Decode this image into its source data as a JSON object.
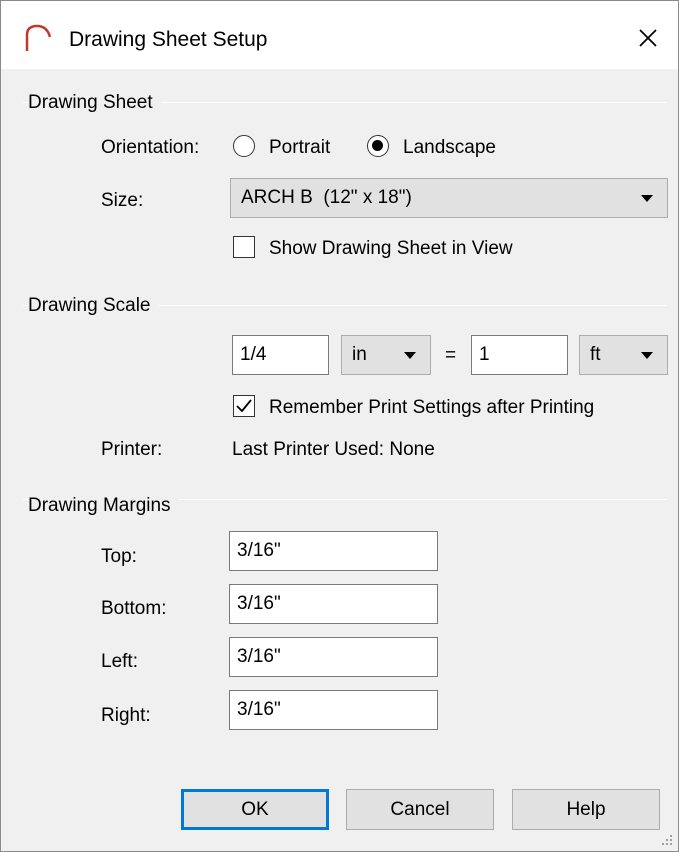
{
  "window": {
    "title": "Drawing Sheet Setup",
    "icon": "arch-icon",
    "accent_color": "#0078d7",
    "icon_color": "#c0392b"
  },
  "drawing_sheet": {
    "group_label": "Drawing Sheet",
    "orientation_label": "Orientation:",
    "portrait_label": "Portrait",
    "landscape_label": "Landscape",
    "orientation_selected": "Landscape",
    "size_label": "Size:",
    "size_value": "ARCH B  (12\" x 18\")",
    "show_sheet_label": "Show Drawing Sheet in View",
    "show_sheet_checked": false
  },
  "drawing_scale": {
    "group_label": "Drawing Scale",
    "left_value": "1/4",
    "left_unit": "in",
    "equals": "=",
    "right_value": "1",
    "right_unit": "ft",
    "remember_label": "Remember Print Settings after Printing",
    "remember_checked": true,
    "printer_label": "Printer:",
    "printer_value": "Last Printer Used: None"
  },
  "drawing_margins": {
    "group_label": "Drawing Margins",
    "top_label": "Top:",
    "top_value": "3/16\"",
    "bottom_label": "Bottom:",
    "bottom_value": "3/16\"",
    "left_label": "Left:",
    "left_value": "3/16\"",
    "right_label": "Right:",
    "right_value": "3/16\""
  },
  "buttons": {
    "ok": "OK",
    "cancel": "Cancel",
    "help": "Help"
  }
}
